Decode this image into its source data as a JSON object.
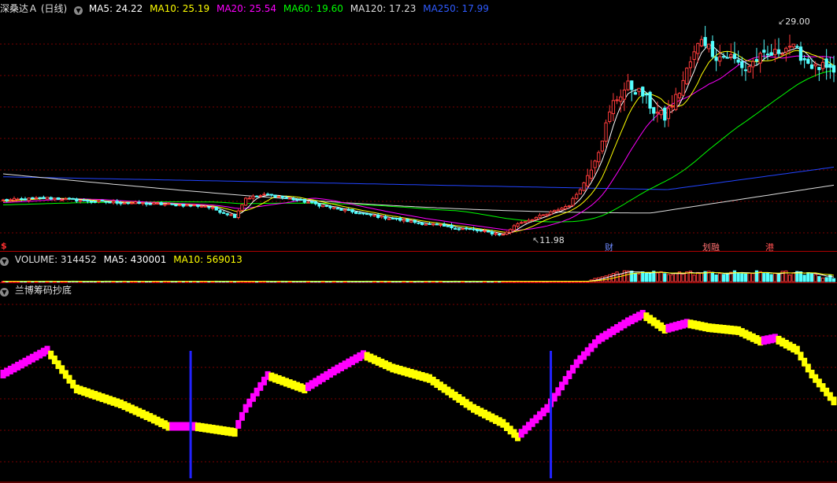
{
  "header": {
    "stock": "深桑达Ａ (日线)",
    "ma5": "MA5: 24.22",
    "ma10": "MA10: 25.19",
    "ma20": "MA20: 25.54",
    "ma60": "MA60: 19.60",
    "ma120": "MA120: 17.23",
    "ma250": "MA250: 17.99"
  },
  "volume_header": {
    "title": "VOLUME: 314452",
    "ma5": "MA5: 430001",
    "ma10": "MA10: 569013"
  },
  "indicator_header": {
    "title": "兰博筹码抄底"
  },
  "price_labels": {
    "high": "29.00",
    "low": "11.98"
  },
  "markers": {
    "left": "$",
    "m1": "财",
    "m2": "融",
    "m2_prefix": "划",
    "m3": "港"
  },
  "colors": {
    "background": "#000000",
    "grid": "#7a0000",
    "up": "#ff3b3b",
    "down": "#54ffff",
    "ma5": "#ffffff",
    "ma10": "#ffff00",
    "ma20": "#ff00ff",
    "ma60": "#00ff00",
    "ma120": "#dddddd",
    "ma250": "#2244ff",
    "indicator_up": "#ff00ff",
    "indicator_down": "#ffff00",
    "signal": "#2222ff"
  },
  "chart_data": [
    {
      "type": "candlestick",
      "title": "深桑达Ａ (日线)",
      "ylim": [
        10.8,
        31.2
      ],
      "series": [
        {
          "name": "MA5",
          "last": 24.22
        },
        {
          "name": "MA10",
          "last": 25.19
        },
        {
          "name": "MA20",
          "last": 25.54
        },
        {
          "name": "MA60",
          "last": 19.6
        },
        {
          "name": "MA120",
          "last": 17.23
        },
        {
          "name": "MA250",
          "last": 17.99
        }
      ],
      "close_path": [
        [
          0,
          15.0
        ],
        [
          12,
          15.2
        ],
        [
          25,
          14.9
        ],
        [
          40,
          14.7
        ],
        [
          55,
          14.5
        ],
        [
          63,
          13.6
        ],
        [
          66,
          15.2
        ],
        [
          72,
          15.5
        ],
        [
          82,
          14.9
        ],
        [
          90,
          14.3
        ],
        [
          98,
          13.8
        ],
        [
          106,
          13.4
        ],
        [
          116,
          12.9
        ],
        [
          128,
          12.4
        ],
        [
          136,
          12.0
        ],
        [
          140,
          13.0
        ],
        [
          148,
          13.8
        ],
        [
          154,
          14.6
        ],
        [
          158,
          16.5
        ],
        [
          162,
          19.5
        ],
        [
          166,
          23.5
        ],
        [
          170,
          25.0
        ],
        [
          174,
          24.2
        ],
        [
          177,
          22.8
        ],
        [
          180,
          22.2
        ],
        [
          184,
          24.5
        ],
        [
          186,
          26.3
        ],
        [
          190,
          29.2
        ],
        [
          194,
          27.5
        ],
        [
          198,
          27.5
        ],
        [
          202,
          26.4
        ],
        [
          205,
          27.3
        ],
        [
          210,
          27.8
        ],
        [
          214,
          28.5
        ],
        [
          218,
          27.3
        ],
        [
          221,
          26.5
        ],
        [
          223,
          26.6
        ],
        [
          226,
          25.9
        ]
      ],
      "annotations": [
        "29.00",
        "11.98"
      ]
    },
    {
      "type": "bar",
      "title": "VOLUME",
      "values_last": {
        "VOLUME": 314452,
        "MA5": 430001,
        "MA10": 569013
      }
    },
    {
      "type": "bar",
      "title": "兰博筹码抄底",
      "path": [
        [
          0,
          50
        ],
        [
          12,
          66
        ],
        [
          20,
          40
        ],
        [
          32,
          30
        ],
        [
          40,
          21
        ],
        [
          45,
          15
        ],
        [
          52,
          15
        ],
        [
          63,
          11
        ],
        [
          66,
          27
        ],
        [
          72,
          49
        ],
        [
          82,
          40
        ],
        [
          90,
          52
        ],
        [
          98,
          63
        ],
        [
          106,
          54
        ],
        [
          116,
          47
        ],
        [
          128,
          27
        ],
        [
          136,
          17
        ],
        [
          140,
          8
        ],
        [
          148,
          27
        ],
        [
          156,
          57
        ],
        [
          162,
          73
        ],
        [
          170,
          85
        ],
        [
          174,
          90
        ],
        [
          180,
          80
        ],
        [
          186,
          84
        ],
        [
          192,
          81
        ],
        [
          200,
          79
        ],
        [
          206,
          72
        ],
        [
          210,
          74
        ],
        [
          216,
          66
        ],
        [
          220,
          50
        ],
        [
          226,
          32
        ]
      ],
      "signals": [
        51,
        149
      ]
    }
  ]
}
